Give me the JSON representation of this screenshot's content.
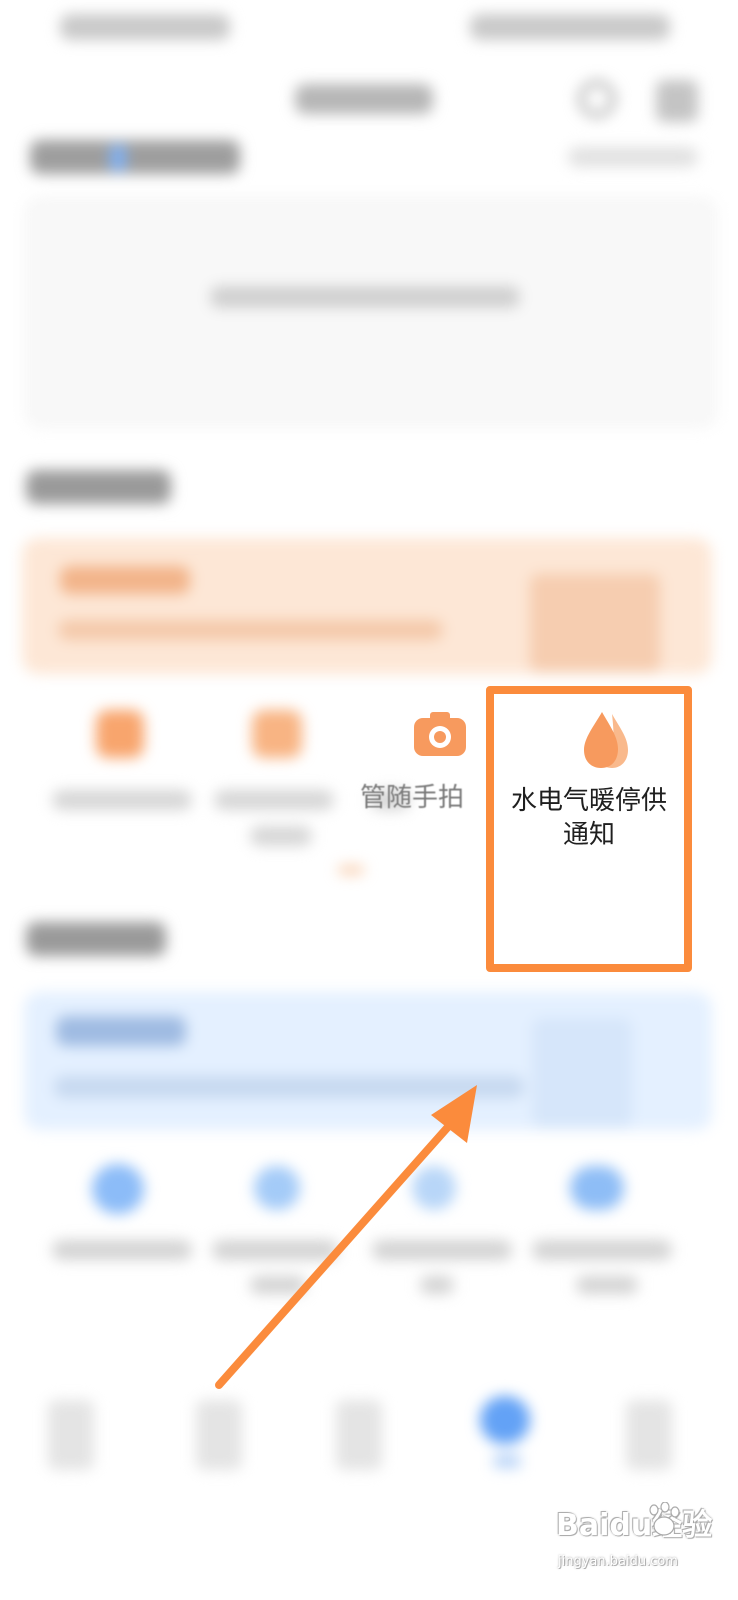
{
  "services": {
    "partial_label": "管随手拍",
    "highlighted_label": "水电气暖停供通知"
  },
  "watermark": {
    "logo_text": "Baidu经验",
    "url": "jingyan.baidu.com"
  },
  "colors": {
    "accent_orange": "#fb8b3c",
    "icon_orange": "#f79a5e",
    "accent_blue": "#63a2f6"
  },
  "icons": {
    "camera": "camera-icon",
    "water": "water-drop-icon",
    "pointer": "arrow-icon"
  }
}
